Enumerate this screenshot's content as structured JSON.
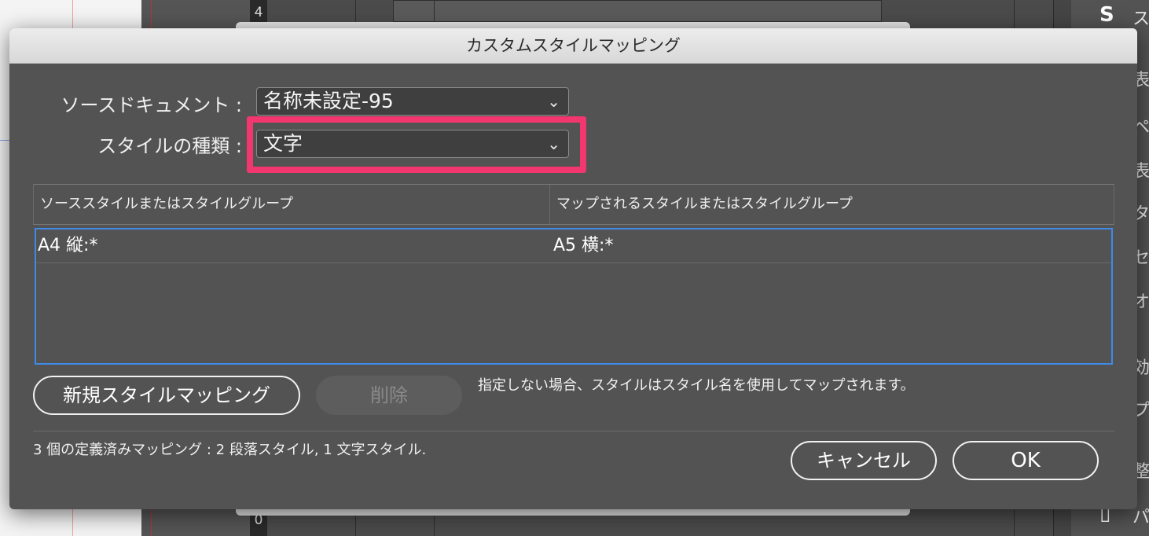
{
  "background": {
    "ruler_top": "4",
    "ruler_bottom": "0",
    "right_panel": [
      {
        "glyph": "S",
        "label": "ス"
      },
      {
        "glyph": "",
        "label": "表"
      },
      {
        "glyph": "",
        "label": "ペ"
      },
      {
        "glyph": "",
        "label": "表"
      },
      {
        "glyph": "",
        "label": "タ"
      },
      {
        "glyph": "",
        "label": "セ"
      },
      {
        "glyph": "",
        "label": "オ"
      },
      {
        "glyph": "",
        "label": "効"
      },
      {
        "glyph": "",
        "label": "プ"
      },
      {
        "glyph": "",
        "label": "整"
      },
      {
        "glyph": "▯",
        "label": "パ"
      }
    ]
  },
  "dialog": {
    "title": "カスタムスタイルマッピング",
    "source_document": {
      "label": "ソースドキュメント :",
      "value": "名称未設定-95"
    },
    "style_type": {
      "label": "スタイルの種類 :",
      "value": "文字"
    },
    "table": {
      "headers": [
        "ソーススタイルまたはスタイルグループ",
        "マップされるスタイルまたはスタイルグループ"
      ],
      "rows": [
        {
          "source": "A4 縦:*",
          "target": "A5 横:*"
        }
      ]
    },
    "buttons": {
      "new_mapping": "新規スタイルマッピング",
      "delete": "削除",
      "cancel": "キャンセル",
      "ok": "OK"
    },
    "note": "指定しない場合、スタイルはスタイル名を使用してマップされます。",
    "summary": "3 個の定義済みマッピング :  2 段落スタイル, 1 文字スタイル."
  },
  "colors": {
    "highlight": "#f2376f",
    "selection": "#3e8be8",
    "dialog_bg": "#535353"
  }
}
